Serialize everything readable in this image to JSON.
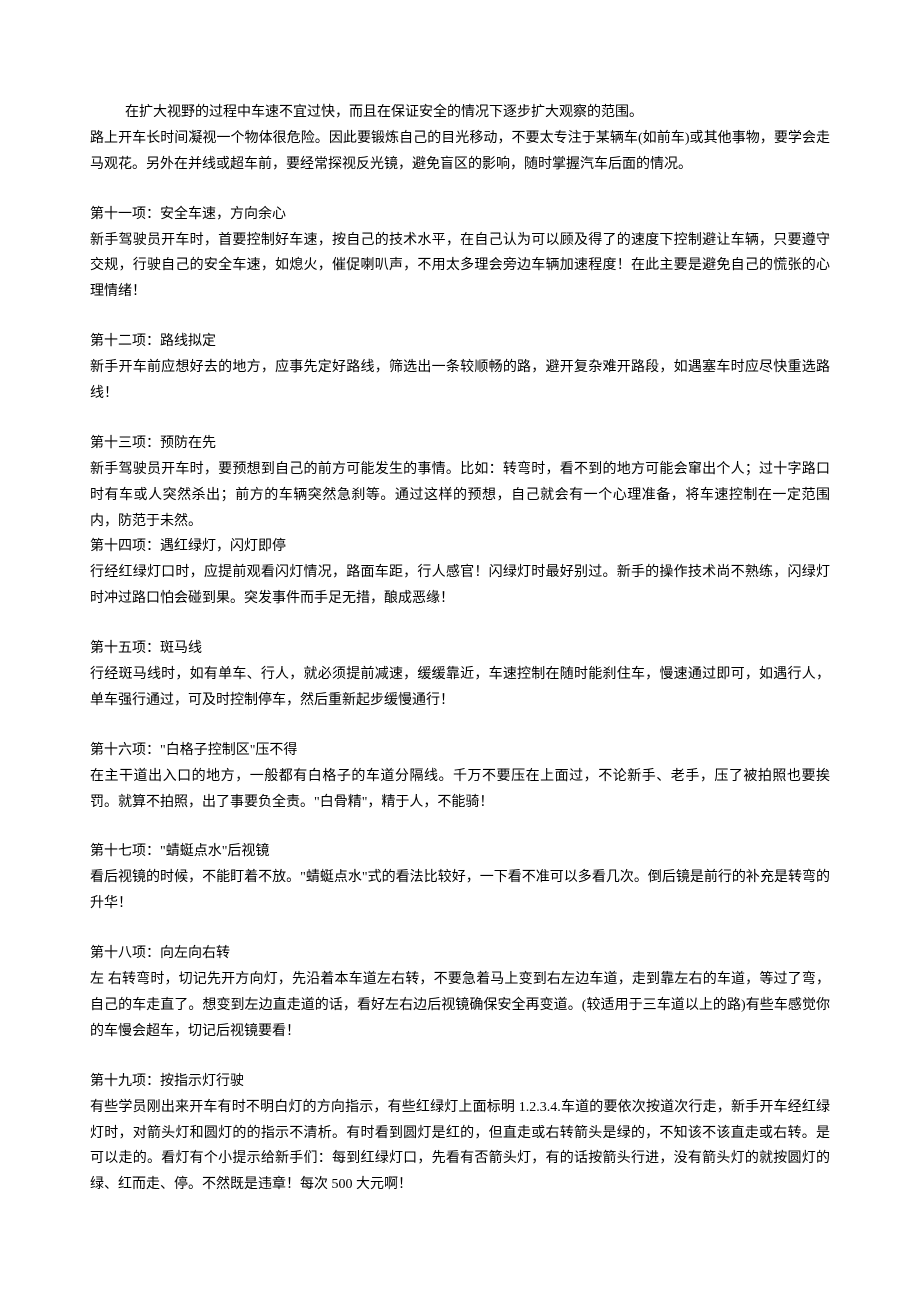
{
  "intro": {
    "line1": "在扩大视野的过程中车速不宜过快，而且在保证安全的情况下逐步扩大观察的范围。",
    "line2": "路上开车长时间凝视一个物体很危险。因此要锻炼自己的目光移动，不要太专注于某辆车(如前车)或其他事物，要学会走马观花。另外在并线或超车前，要经常探视反光镜，避免盲区的影响，随时掌握汽车后面的情况。"
  },
  "sections": [
    {
      "title": "第十一项：安全车速，方向余心",
      "body": "新手驾驶员开车时，首要控制好车速，按自己的技术水平，在自己认为可以顾及得了的速度下控制避让车辆，只要遵守交规，行驶自己的安全车速，如熄火，催促喇叭声，不用太多理会旁边车辆加速程度！在此主要是避免自己的慌张的心理情绪！"
    },
    {
      "title": "第十二项：路线拟定",
      "body": "新手开车前应想好去的地方，应事先定好路线，筛选出一条较顺畅的路，避开复杂难开路段，如遇塞车时应尽快重选路线！"
    },
    {
      "title": "第十三项：预防在先",
      "body": "新手驾驶员开车时，要预想到自己的前方可能发生的事情。比如：转弯时，看不到的地方可能会窜出个人；过十字路口时有车或人突然杀出；前方的车辆突然急刹等。通过这样的预想，自己就会有一个心理准备，将车速控制在一定范围内，防范于未然。",
      "title2": "第十四项：遇红绿灯，闪灯即停",
      "body2": "行经红绿灯口时，应提前观看闪灯情况，路面车距，行人感官！闪绿灯时最好别过。新手的操作技术尚不熟练，闪绿灯时冲过路口怕会碰到果。突发事件而手足无措，酿成恶缘！"
    },
    {
      "title": "第十五项：斑马线",
      "body": "行经斑马线时，如有单车、行人，就必须提前减速，缓缓靠近，车速控制在随时能刹住车，慢速通过即可，如遇行人，单车强行通过，可及时控制停车，然后重新起步缓慢通行！"
    },
    {
      "title": "第十六项：\"白格子控制区\"压不得",
      "body": "在主干道出入口的地方，一般都有白格子的车道分隔线。千万不要压在上面过，不论新手、老手，压了被拍照也要挨罚。就算不拍照，出了事要负全责。\"白骨精\"，精于人，不能骑！"
    },
    {
      "title": "第十七项：\"蜻蜓点水\"后视镜",
      "body": "看后视镜的时候，不能盯着不放。\"蜻蜓点水\"式的看法比较好，一下看不准可以多看几次。倒后镜是前行的补充是转弯的升华！"
    },
    {
      "title": "第十八项：向左向右转",
      "body": "左 右转弯时，切记先开方向灯，先沿着本车道左右转，不要急着马上变到右左边车道，走到靠左右的车道，等过了弯，自己的车走直了。想变到左边直走道的话，看好左右边后视镜确保安全再变道。(较适用于三车道以上的路)有些车感觉你的车慢会超车，切记后视镜要看！"
    },
    {
      "title": "第十九项：按指示灯行驶",
      "body": "有些学员刚出来开车有时不明白灯的方向指示，有些红绿灯上面标明 1.2.3.4.车道的要依次按道次行走，新手开车经红绿灯时，对箭头灯和圆灯的的指示不清析。有时看到圆灯是红的，但直走或右转箭头是绿的，不知该不该直走或右转。是可以走的。看灯有个小提示给新手们：每到红绿灯口，先看有否箭头灯，有的话按箭头行进，没有箭头灯的就按圆灯的绿、红而走、停。不然既是违章！每次 500 大元啊！"
    }
  ]
}
